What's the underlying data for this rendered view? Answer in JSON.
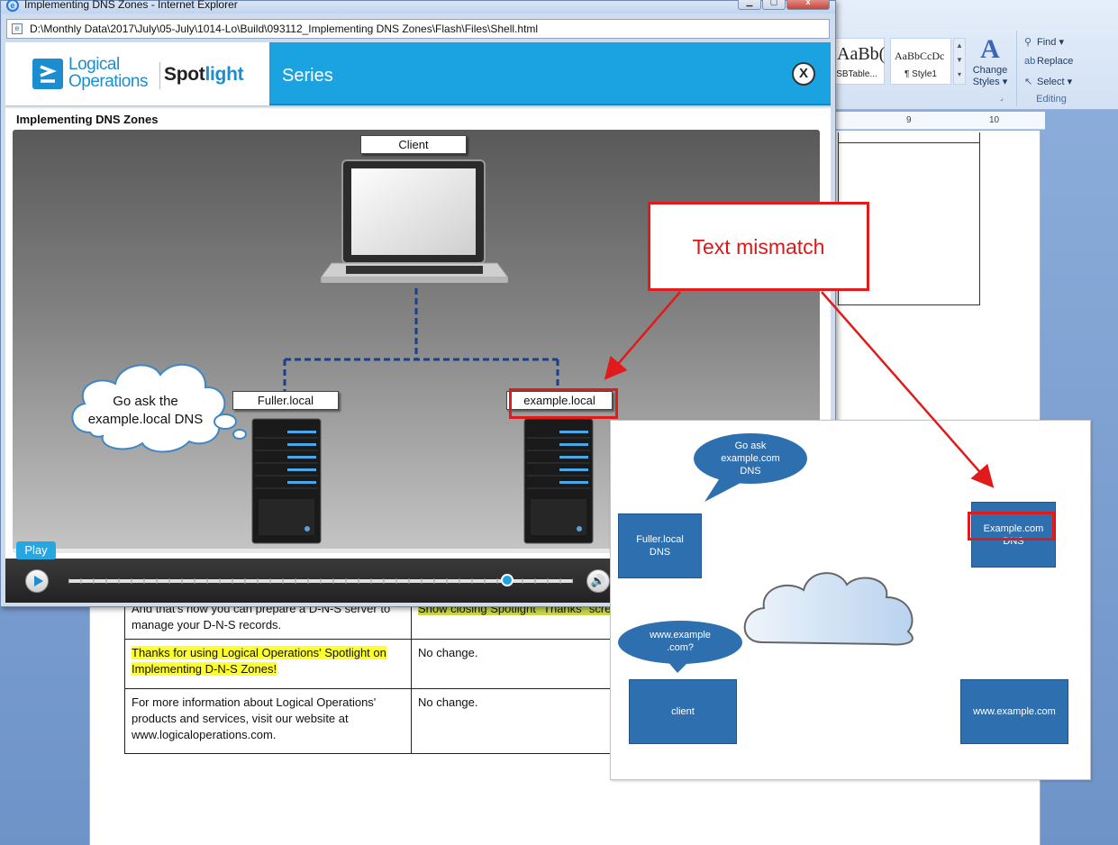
{
  "ie_window": {
    "title": "Implementing DNS Zones - Internet Explorer",
    "address": "D:\\Monthly Data\\2017\\July\\05-July\\1014-Lo\\Build\\093112_Implementing DNS Zones\\Flash\\Files\\Shell.html",
    "close_glyph": "x"
  },
  "spotlight": {
    "logo_line1": "Logical",
    "logo_line2": "Operations",
    "brand_spot": "Spot",
    "brand_light": "light",
    "series_label": "Series",
    "close_label": "X",
    "lesson_title": "Implementing DNS Zones",
    "stage": {
      "client_label": "Client",
      "fuller_label": "Fuller.local",
      "example_label": "example.local",
      "thought_line1": "Go ask the",
      "thought_line2": "example.local DNS"
    },
    "player": {
      "play_tip": "Play",
      "progress": 0.87,
      "volume_glyph": "🔊"
    }
  },
  "word_ribbon": {
    "style1_sample": "AaBb(",
    "style1_name": "SBTable...",
    "style2_sample": "AaBbCcDc",
    "style2_name": "¶ Style1",
    "change_styles_line1": "Change",
    "change_styles_line2": "Styles",
    "find": "Find",
    "replace": "Replace",
    "select": "Select",
    "editing": "Editing",
    "ruler_9": "9",
    "ruler_10": "10"
  },
  "doc_table": {
    "rows": [
      {
        "left": "And that's how you can prepare a D-N-S server to manage your D-N-S records.",
        "right": "Show closing Spotlight \"Thanks\" scre"
      },
      {
        "left": "Thanks for using Logical Operations' Spotlight on Implementing D-N-S Zones!",
        "right": "No change."
      },
      {
        "left": "For more information about Logical Operations' products and services, visit our website at www.logicaloperations.com.",
        "right": "No change."
      }
    ]
  },
  "annotation": {
    "callout": "Text mismatch",
    "color": "#e11b1b"
  },
  "storyboard": {
    "bubble_top_line1": "Go ask",
    "bubble_top_line2": "example.com",
    "bubble_top_line3": "DNS",
    "fuller_line1": "Fuller.local",
    "fuller_line2": "DNS",
    "example_line1": "Example.com",
    "example_line2": "DNS",
    "bubble_bottom_line1": "www.example",
    "bubble_bottom_line2": ".com?",
    "client": "client",
    "www": "www.example.com",
    "box_color": "#2e6faf"
  }
}
